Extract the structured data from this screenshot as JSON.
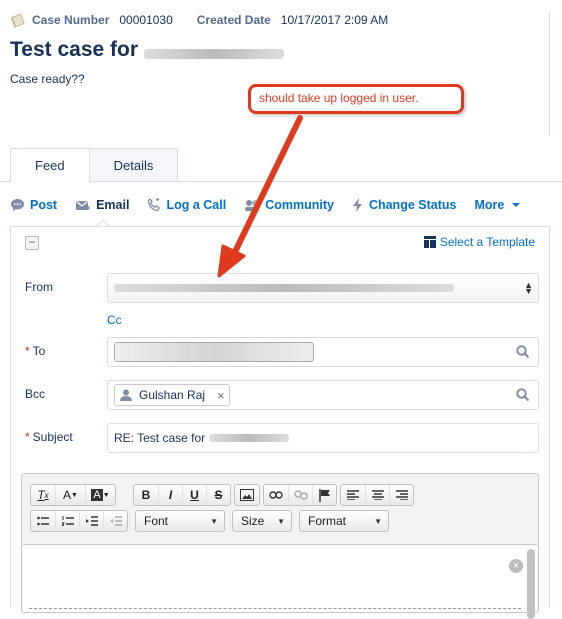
{
  "header": {
    "case_number_label": "Case Number",
    "case_number": "00001030",
    "created_date_label": "Created Date",
    "created_date": "10/17/2017 2:09 AM",
    "title": "Test case for",
    "description": "Case ready??"
  },
  "annotation": {
    "callout_text": "should take up logged in user."
  },
  "tabs": [
    {
      "label": "Feed"
    },
    {
      "label": "Details"
    }
  ],
  "actions": [
    {
      "label": "Post",
      "icon": "chat-icon"
    },
    {
      "label": "Email",
      "icon": "envelope-icon"
    },
    {
      "label": "Log a Call",
      "icon": "phone-icon"
    },
    {
      "label": "Community",
      "icon": "community-icon"
    },
    {
      "label": "Change Status",
      "icon": "lightning-icon"
    },
    {
      "label": "More",
      "icon": "chevron-down-icon"
    }
  ],
  "email_form": {
    "collapse_label": "−",
    "select_template": "Select a Template",
    "from_label": "From",
    "cc_label": "Cc",
    "to_label": "To",
    "bcc_label": "Bcc",
    "bcc_recipient": "Gulshan Raj",
    "subject_label": "Subject",
    "required_marker": "*",
    "subject_value": "RE: Test case for"
  },
  "editor": {
    "font_label": "Font",
    "size_label": "Size",
    "format_label": "Format"
  },
  "colors": {
    "link": "#0070d2",
    "text": "#16325c",
    "annotation": "#e03a1e",
    "required": "#c23934"
  }
}
